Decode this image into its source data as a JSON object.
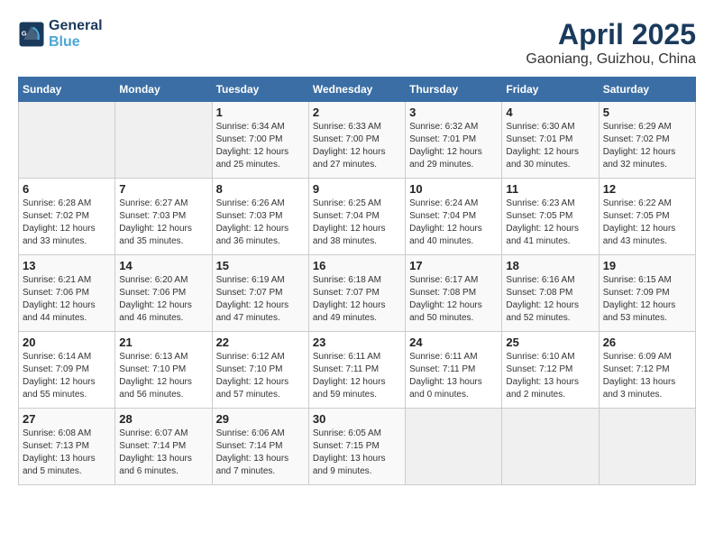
{
  "header": {
    "logo_line1": "General",
    "logo_line2": "Blue",
    "month_year": "April 2025",
    "location": "Gaoniang, Guizhou, China"
  },
  "weekdays": [
    "Sunday",
    "Monday",
    "Tuesday",
    "Wednesday",
    "Thursday",
    "Friday",
    "Saturday"
  ],
  "weeks": [
    [
      {
        "day": "",
        "info": ""
      },
      {
        "day": "",
        "info": ""
      },
      {
        "day": "1",
        "info": "Sunrise: 6:34 AM\nSunset: 7:00 PM\nDaylight: 12 hours\nand 25 minutes."
      },
      {
        "day": "2",
        "info": "Sunrise: 6:33 AM\nSunset: 7:00 PM\nDaylight: 12 hours\nand 27 minutes."
      },
      {
        "day": "3",
        "info": "Sunrise: 6:32 AM\nSunset: 7:01 PM\nDaylight: 12 hours\nand 29 minutes."
      },
      {
        "day": "4",
        "info": "Sunrise: 6:30 AM\nSunset: 7:01 PM\nDaylight: 12 hours\nand 30 minutes."
      },
      {
        "day": "5",
        "info": "Sunrise: 6:29 AM\nSunset: 7:02 PM\nDaylight: 12 hours\nand 32 minutes."
      }
    ],
    [
      {
        "day": "6",
        "info": "Sunrise: 6:28 AM\nSunset: 7:02 PM\nDaylight: 12 hours\nand 33 minutes."
      },
      {
        "day": "7",
        "info": "Sunrise: 6:27 AM\nSunset: 7:03 PM\nDaylight: 12 hours\nand 35 minutes."
      },
      {
        "day": "8",
        "info": "Sunrise: 6:26 AM\nSunset: 7:03 PM\nDaylight: 12 hours\nand 36 minutes."
      },
      {
        "day": "9",
        "info": "Sunrise: 6:25 AM\nSunset: 7:04 PM\nDaylight: 12 hours\nand 38 minutes."
      },
      {
        "day": "10",
        "info": "Sunrise: 6:24 AM\nSunset: 7:04 PM\nDaylight: 12 hours\nand 40 minutes."
      },
      {
        "day": "11",
        "info": "Sunrise: 6:23 AM\nSunset: 7:05 PM\nDaylight: 12 hours\nand 41 minutes."
      },
      {
        "day": "12",
        "info": "Sunrise: 6:22 AM\nSunset: 7:05 PM\nDaylight: 12 hours\nand 43 minutes."
      }
    ],
    [
      {
        "day": "13",
        "info": "Sunrise: 6:21 AM\nSunset: 7:06 PM\nDaylight: 12 hours\nand 44 minutes."
      },
      {
        "day": "14",
        "info": "Sunrise: 6:20 AM\nSunset: 7:06 PM\nDaylight: 12 hours\nand 46 minutes."
      },
      {
        "day": "15",
        "info": "Sunrise: 6:19 AM\nSunset: 7:07 PM\nDaylight: 12 hours\nand 47 minutes."
      },
      {
        "day": "16",
        "info": "Sunrise: 6:18 AM\nSunset: 7:07 PM\nDaylight: 12 hours\nand 49 minutes."
      },
      {
        "day": "17",
        "info": "Sunrise: 6:17 AM\nSunset: 7:08 PM\nDaylight: 12 hours\nand 50 minutes."
      },
      {
        "day": "18",
        "info": "Sunrise: 6:16 AM\nSunset: 7:08 PM\nDaylight: 12 hours\nand 52 minutes."
      },
      {
        "day": "19",
        "info": "Sunrise: 6:15 AM\nSunset: 7:09 PM\nDaylight: 12 hours\nand 53 minutes."
      }
    ],
    [
      {
        "day": "20",
        "info": "Sunrise: 6:14 AM\nSunset: 7:09 PM\nDaylight: 12 hours\nand 55 minutes."
      },
      {
        "day": "21",
        "info": "Sunrise: 6:13 AM\nSunset: 7:10 PM\nDaylight: 12 hours\nand 56 minutes."
      },
      {
        "day": "22",
        "info": "Sunrise: 6:12 AM\nSunset: 7:10 PM\nDaylight: 12 hours\nand 57 minutes."
      },
      {
        "day": "23",
        "info": "Sunrise: 6:11 AM\nSunset: 7:11 PM\nDaylight: 12 hours\nand 59 minutes."
      },
      {
        "day": "24",
        "info": "Sunrise: 6:11 AM\nSunset: 7:11 PM\nDaylight: 13 hours\nand 0 minutes."
      },
      {
        "day": "25",
        "info": "Sunrise: 6:10 AM\nSunset: 7:12 PM\nDaylight: 13 hours\nand 2 minutes."
      },
      {
        "day": "26",
        "info": "Sunrise: 6:09 AM\nSunset: 7:12 PM\nDaylight: 13 hours\nand 3 minutes."
      }
    ],
    [
      {
        "day": "27",
        "info": "Sunrise: 6:08 AM\nSunset: 7:13 PM\nDaylight: 13 hours\nand 5 minutes."
      },
      {
        "day": "28",
        "info": "Sunrise: 6:07 AM\nSunset: 7:14 PM\nDaylight: 13 hours\nand 6 minutes."
      },
      {
        "day": "29",
        "info": "Sunrise: 6:06 AM\nSunset: 7:14 PM\nDaylight: 13 hours\nand 7 minutes."
      },
      {
        "day": "30",
        "info": "Sunrise: 6:05 AM\nSunset: 7:15 PM\nDaylight: 13 hours\nand 9 minutes."
      },
      {
        "day": "",
        "info": ""
      },
      {
        "day": "",
        "info": ""
      },
      {
        "day": "",
        "info": ""
      }
    ]
  ]
}
